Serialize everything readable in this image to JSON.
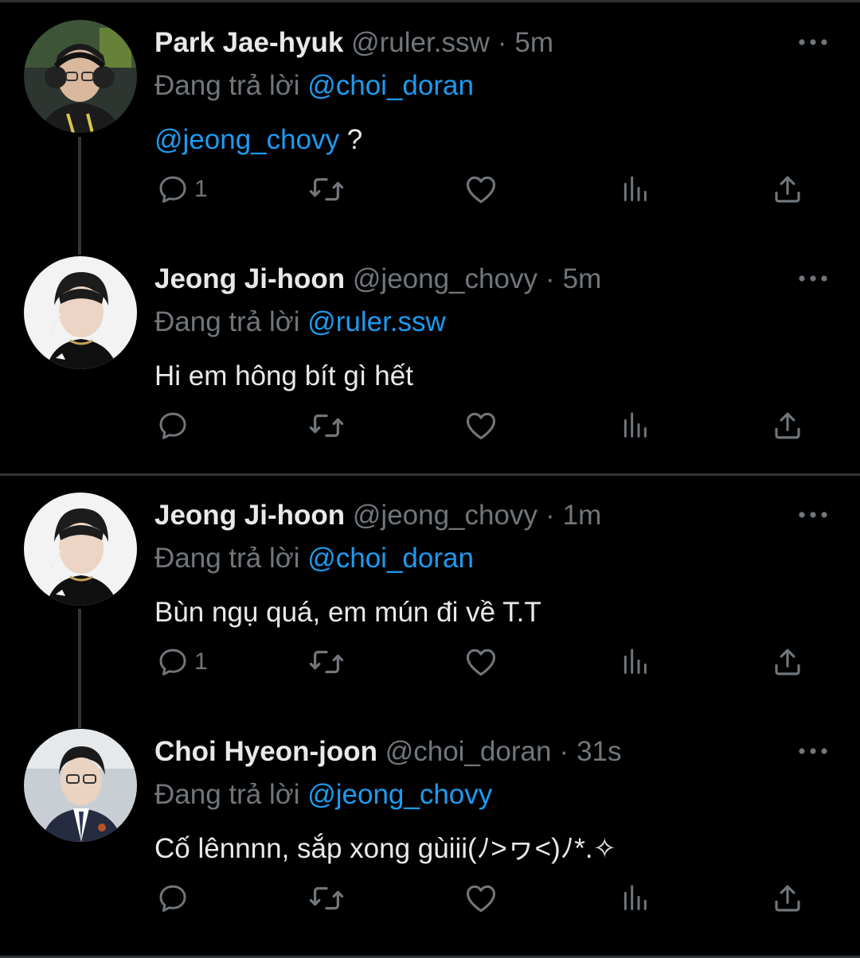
{
  "reply_prefix": "Đang trả lời",
  "colors": {
    "background": "#000000",
    "text": "#e7e9ea",
    "muted": "#71767b",
    "accent": "#1d9bf0",
    "divider": "#2f3336"
  },
  "icons": {
    "reply": "reply-icon",
    "retweet": "retweet-icon",
    "like": "heart-icon",
    "views": "views-icon",
    "share": "share-icon",
    "more": "more-icon"
  },
  "tweets": [
    {
      "display_name": "Park Jae-hyuk",
      "handle": "@ruler.ssw",
      "separator": "·",
      "time": "5m",
      "replying_to": "@choi_doran",
      "text_mention": "@jeong_chovy",
      "text": " ?",
      "reply_count": "1"
    },
    {
      "display_name": "Jeong Ji-hoon",
      "handle": "@jeong_chovy",
      "separator": "·",
      "time": "5m",
      "replying_to": "@ruler.ssw",
      "text": "Hi em hông bít gì hết",
      "reply_count": ""
    },
    {
      "display_name": "Jeong Ji-hoon",
      "handle": "@jeong_chovy",
      "separator": "·",
      "time": "1m",
      "replying_to": "@choi_doran",
      "text": "Bùn ngụ quá, em mún đi về T.T",
      "reply_count": "1"
    },
    {
      "display_name": "Choi Hyeon-joon",
      "handle": "@choi_doran",
      "separator": "·",
      "time": "31s",
      "replying_to": "@jeong_chovy",
      "text": "Cố lênnnn, sắp xong gùiii(ﾉ>ヮ<)ﾉ*.✧",
      "reply_count": ""
    }
  ]
}
